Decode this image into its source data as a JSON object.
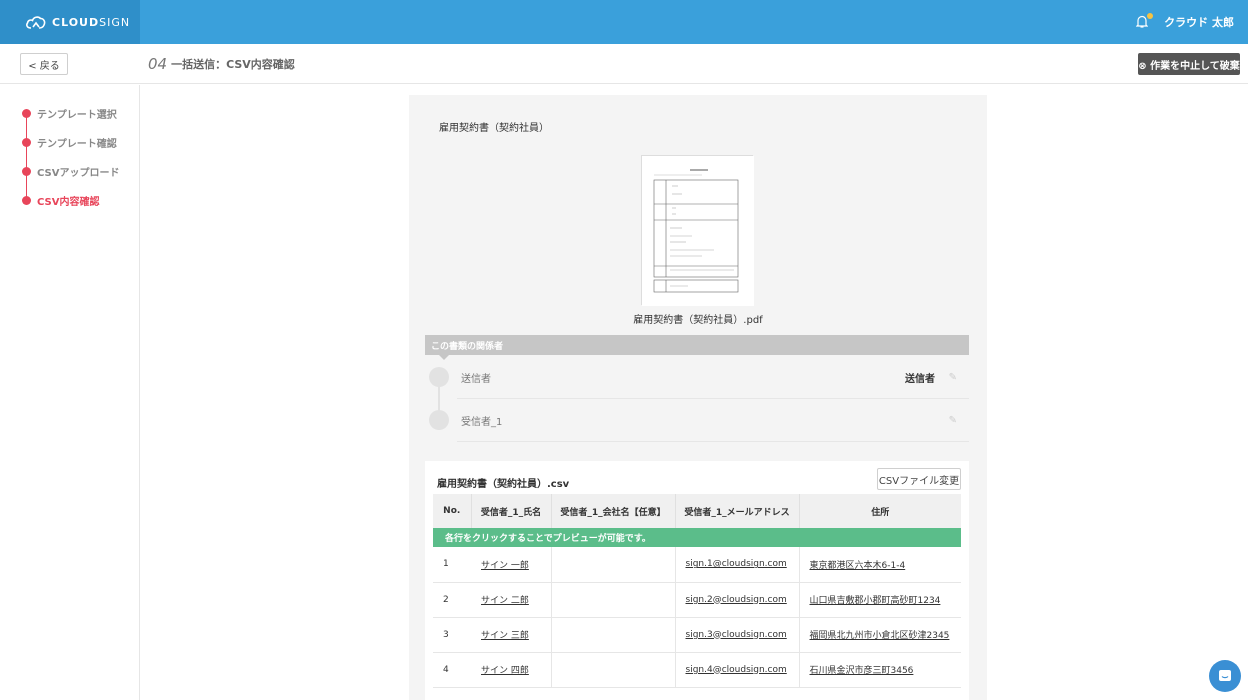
{
  "brand": {
    "name_bold": "CLOUD",
    "name_light": "SIGN"
  },
  "user": {
    "name": "クラウド 太郎"
  },
  "subheader": {
    "back_label": "< 戻る",
    "step_number": "04",
    "step_title": "一括送信：CSV内容確認",
    "abort_label": "⊗ 作業を中止して破棄"
  },
  "sidebar": {
    "steps": [
      {
        "label": "テンプレート選択"
      },
      {
        "label": "テンプレート確認"
      },
      {
        "label": "CSVアップロード"
      },
      {
        "label": "CSV内容確認"
      }
    ]
  },
  "document": {
    "title": "雇用契約書（契約社員）",
    "pdf_name": "雇用契約書（契約社員）.pdf"
  },
  "relations": {
    "header": "この書類の関係者",
    "parties": [
      {
        "name": "送信者",
        "role": "送信者"
      },
      {
        "name": "受信者_1",
        "role": ""
      }
    ]
  },
  "csv": {
    "file_name": "雇用契約書（契約社員）.csv",
    "change_button": "CSVファイル変更",
    "columns": [
      "No.",
      "受信者_1_氏名",
      "受信者_1_会社名【任意】",
      "受信者_1_メールアドレス",
      "住所"
    ],
    "notice": "各行をクリックすることでプレビューが可能です。",
    "rows": [
      {
        "no": "1",
        "name": "サイン 一郎",
        "company": "",
        "email": "sign.1@cloudsign.com",
        "address": "東京都港区六本木6-1-4"
      },
      {
        "no": "2",
        "name": "サイン 二郎",
        "company": "",
        "email": "sign.2@cloudsign.com",
        "address": "山口県吉敷郡小郡町高砂町1234"
      },
      {
        "no": "3",
        "name": "サイン 三郎",
        "company": "",
        "email": "sign.3@cloudsign.com",
        "address": "福岡県北九州市小倉北区砂津2345"
      },
      {
        "no": "4",
        "name": "サイン 四郎",
        "company": "",
        "email": "sign.4@cloudsign.com",
        "address": "石川県金沢市彦三町3456"
      }
    ]
  },
  "colors": {
    "topbar": "#3aa0db",
    "brand_bg": "#2f8fc9",
    "accent_red": "#e8455a",
    "notice_green": "#5bbd8a",
    "abort_bg": "#555555",
    "chat_blue": "#3a8fd4"
  }
}
